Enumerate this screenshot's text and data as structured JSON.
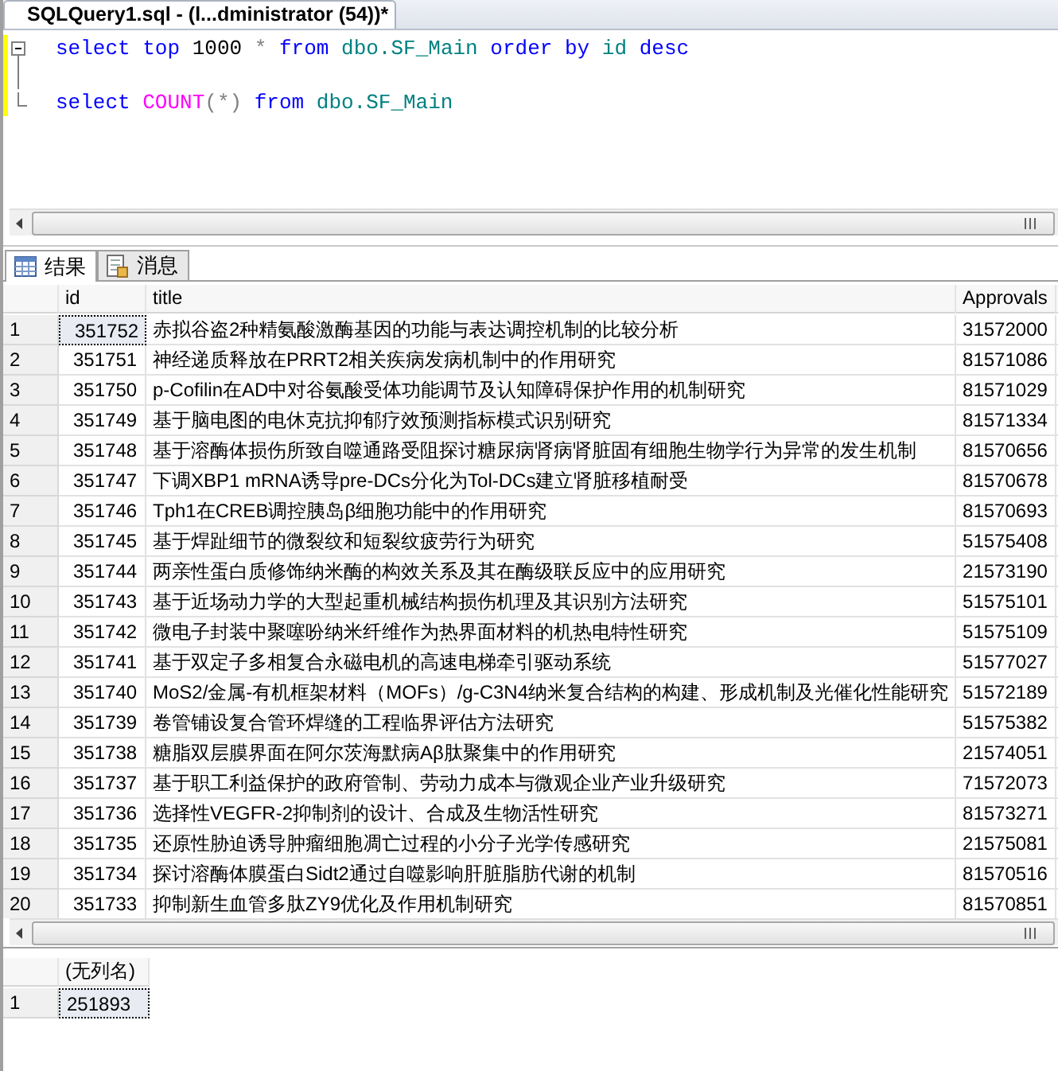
{
  "document_tab": {
    "title": "SQLQuery1.sql - (l...dministrator (54))*",
    "selected": true
  },
  "editor": {
    "lines": [
      {
        "kind": "start",
        "changed": true,
        "tokens": [
          {
            "text": "select",
            "kind": "keyword"
          },
          {
            "text": "top",
            "kind": "keyword"
          },
          {
            "text": "1000",
            "kind": "number"
          },
          {
            "text": "*",
            "kind": "operator"
          },
          {
            "text": "from",
            "kind": "keyword"
          },
          {
            "text": "dbo.SF_Main",
            "kind": "object"
          },
          {
            "text": "order",
            "kind": "keyword"
          },
          {
            "text": "by",
            "kind": "keyword"
          },
          {
            "text": "id",
            "kind": "object"
          },
          {
            "text": "desc",
            "kind": "keyword"
          }
        ]
      },
      {
        "kind": "middle",
        "changed": true
      },
      {
        "kind": "end",
        "changed": true,
        "tokens": [
          {
            "text": "select",
            "kind": "keyword"
          },
          {
            "text": "COUNT",
            "kind": "function"
          },
          {
            "text": "(*)",
            "kind": "operator",
            "joined": true
          },
          {
            "text": "from",
            "kind": "keyword"
          },
          {
            "text": "dbo.SF_Main",
            "kind": "object"
          }
        ]
      }
    ]
  },
  "result_tabs": [
    {
      "label": "结果",
      "kind": "grid",
      "selected": true
    },
    {
      "label": "消息",
      "kind": "messages",
      "selected": false
    }
  ],
  "grids": [
    {
      "columns": [
        "id",
        "title",
        "Approvals"
      ],
      "rows": [
        {
          "number": "1",
          "selected": true,
          "cells": [
            "351752",
            "赤拟谷盗2种精氨酸激酶基因的功能与表达调控机制的比较分析",
            "31572000"
          ]
        },
        {
          "number": "2",
          "selected": false,
          "cells": [
            "351751",
            "神经递质释放在PRRT2相关疾病发病机制中的作用研究",
            "81571086"
          ]
        },
        {
          "number": "3",
          "selected": false,
          "cells": [
            "351750",
            "p-Cofilin在AD中对谷氨酸受体功能调节及认知障碍保护作用的机制研究",
            "81571029"
          ]
        },
        {
          "number": "4",
          "selected": false,
          "cells": [
            "351749",
            "基于脑电图的电休克抗抑郁疗效预测指标模式识别研究",
            "81571334"
          ]
        },
        {
          "number": "5",
          "selected": false,
          "cells": [
            "351748",
            "基于溶酶体损伤所致自噬通路受阻探讨糖尿病肾病肾脏固有细胞生物学行为异常的发生机制",
            "81570656"
          ]
        },
        {
          "number": "6",
          "selected": false,
          "cells": [
            "351747",
            "下调XBP1 mRNA诱导pre-DCs分化为Tol-DCs建立肾脏移植耐受",
            "81570678"
          ]
        },
        {
          "number": "7",
          "selected": false,
          "cells": [
            "351746",
            "Tph1在CREB调控胰岛β细胞功能中的作用研究",
            "81570693"
          ]
        },
        {
          "number": "8",
          "selected": false,
          "cells": [
            "351745",
            "基于焊趾细节的微裂纹和短裂纹疲劳行为研究",
            "51575408"
          ]
        },
        {
          "number": "9",
          "selected": false,
          "cells": [
            "351744",
            "两亲性蛋白质修饰纳米酶的构效关系及其在酶级联反应中的应用研究",
            "21573190"
          ]
        },
        {
          "number": "10",
          "selected": false,
          "cells": [
            "351743",
            "基于近场动力学的大型起重机械结构损伤机理及其识别方法研究",
            "51575101"
          ]
        },
        {
          "number": "11",
          "selected": false,
          "cells": [
            "351742",
            "微电子封装中聚噻吩纳米纤维作为热界面材料的机热电特性研究",
            "51575109"
          ]
        },
        {
          "number": "12",
          "selected": false,
          "cells": [
            "351741",
            "基于双定子多相复合永磁电机的高速电梯牵引驱动系统",
            "51577027"
          ]
        },
        {
          "number": "13",
          "selected": false,
          "cells": [
            "351740",
            "MoS2/金属-有机框架材料（MOFs）/g-C3N4纳米复合结构的构建、形成机制及光催化性能研究",
            "51572189"
          ]
        },
        {
          "number": "14",
          "selected": false,
          "cells": [
            "351739",
            "卷管铺设复合管环焊缝的工程临界评估方法研究",
            "51575382"
          ]
        },
        {
          "number": "15",
          "selected": false,
          "cells": [
            "351738",
            "糖脂双层膜界面在阿尔茨海默病Aβ肽聚集中的作用研究",
            "21574051"
          ]
        },
        {
          "number": "16",
          "selected": false,
          "cells": [
            "351737",
            "基于职工利益保护的政府管制、劳动力成本与微观企业产业升级研究",
            "71572073"
          ]
        },
        {
          "number": "17",
          "selected": false,
          "cells": [
            "351736",
            "选择性VEGFR-2抑制剂的设计、合成及生物活性研究",
            "81573271"
          ]
        },
        {
          "number": "18",
          "selected": false,
          "cells": [
            "351735",
            "还原性胁迫诱导肿瘤细胞凋亡过程的小分子光学传感研究",
            "21575081"
          ]
        },
        {
          "number": "19",
          "selected": false,
          "cells": [
            "351734",
            "探讨溶酶体膜蛋白Sidt2通过自噬影响肝脏脂肪代谢的机制",
            "81570516"
          ]
        },
        {
          "number": "20",
          "selected": false,
          "cells": [
            "351733",
            "抑制新生血管多肽ZY9优化及作用机制研究",
            "81570851"
          ]
        }
      ]
    },
    {
      "columns": [
        "(无列名)"
      ],
      "rows": [
        {
          "number": "1",
          "selected": true,
          "cells": [
            "251893"
          ]
        }
      ]
    }
  ]
}
